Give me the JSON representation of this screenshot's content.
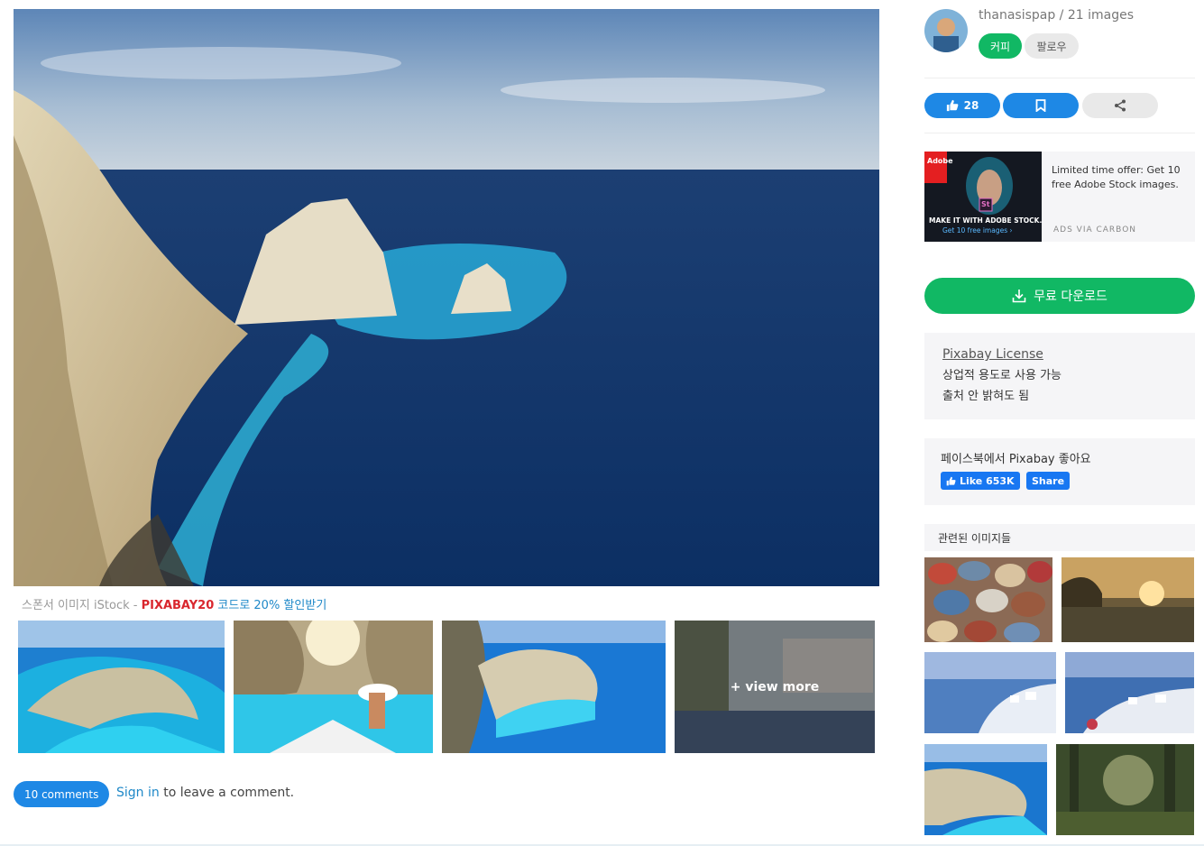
{
  "main": {
    "sponsor_prefix": "스폰서 이미지 iStock - ",
    "sponsor_code": "PIXABAY20",
    "sponsor_link": " 코드로 20% 할인받기",
    "view_more": "+ view more",
    "comments_count": "10 comments",
    "signin_link": "Sign in",
    "signin_rest": " to leave a comment."
  },
  "sidebar": {
    "user": "thanasispap / 21 images",
    "coffee_label": "커피",
    "follow_label": "팔로우",
    "likes": "28",
    "ad": {
      "text": "Limited time offer: Get 10 free Adobe Stock images.",
      "by": "ADS VIA CARBON",
      "make": "MAKE IT WITH ADOBE STOCK.",
      "get": "Get 10 free images ›",
      "brand": "Adobe",
      "st": "St"
    },
    "download_label": "무료 다운로드",
    "license": {
      "title": "Pixabay License",
      "line1": "상업적 용도로 사용 가능",
      "line2": "출처 안 밝혀도 됨"
    },
    "facebook": {
      "title": "페이스북에서 Pixabay 좋아요",
      "like_label": "Like 653K",
      "share_label": "Share"
    },
    "related_title": "관련된 이미지들"
  },
  "colors": {
    "primary_blue": "#1e88e5",
    "green": "#11b864",
    "panel": "#f5f5f7",
    "promo_red": "#d9272e"
  }
}
